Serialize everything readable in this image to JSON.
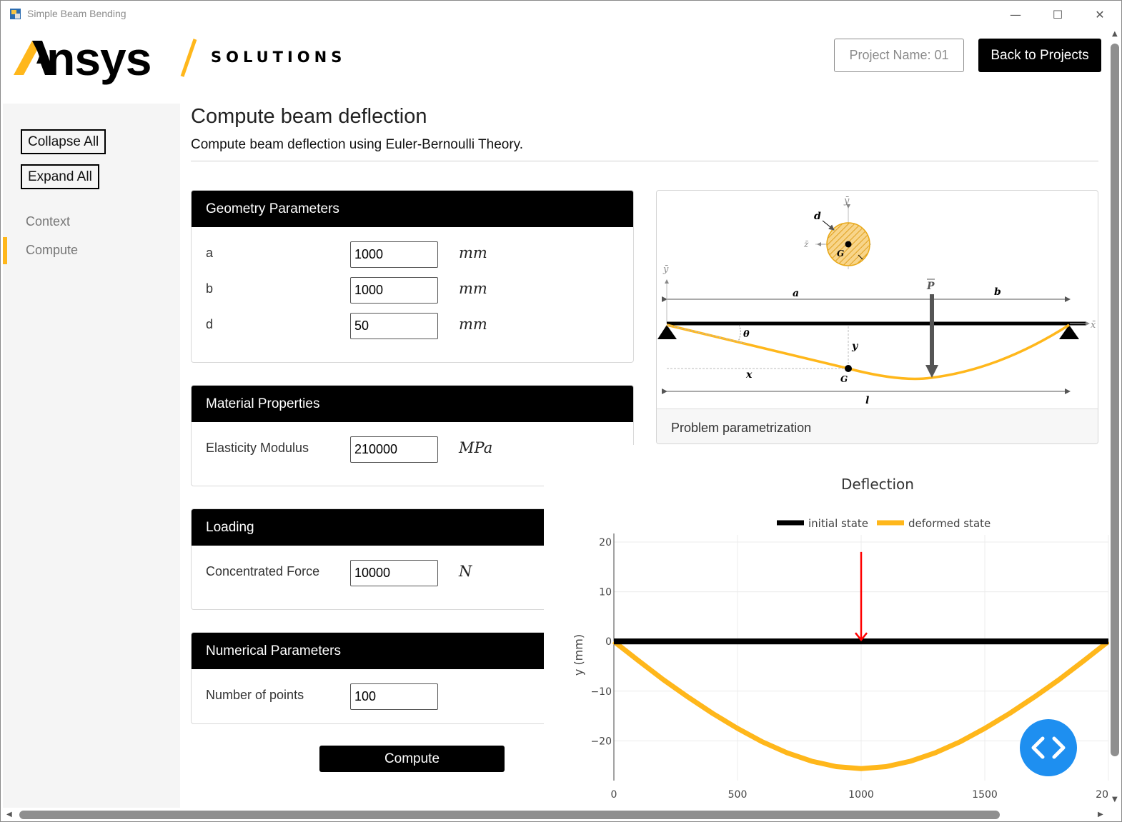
{
  "window": {
    "title": "Simple Beam Bending",
    "minimize": "—",
    "maximize": "☐",
    "close": "✕"
  },
  "header": {
    "logo_text": "nsys",
    "solutions": "SOLUTIONS",
    "project_name": "Project Name: 01",
    "back_label": "Back to Projects"
  },
  "sidebar": {
    "collapse_label": "Collapse All",
    "expand_label": "Expand All",
    "items": [
      {
        "label": "Context",
        "active": false
      },
      {
        "label": "Compute",
        "active": true
      }
    ]
  },
  "main": {
    "title": "Compute beam deflection",
    "subtitle": "Compute beam deflection using Euler-Bernoulli Theory.",
    "cards": {
      "geometry": {
        "title": "Geometry Parameters",
        "rows": [
          {
            "label": "a",
            "value": "1000",
            "unit": "mm"
          },
          {
            "label": "b",
            "value": "1000",
            "unit": "mm"
          },
          {
            "label": "d",
            "value": "50",
            "unit": "mm"
          }
        ]
      },
      "material": {
        "title": "Material Properties",
        "rows": [
          {
            "label": "Elasticity Modulus",
            "value": "210000",
            "unit": "MPa"
          }
        ]
      },
      "loading": {
        "title": "Loading",
        "rows": [
          {
            "label": "Concentrated Force",
            "value": "10000",
            "unit": "N"
          }
        ]
      },
      "numerical": {
        "title": "Numerical Parameters",
        "rows": [
          {
            "label": "Number of points",
            "value": "100"
          }
        ]
      }
    },
    "compute_label": "Compute"
  },
  "figure": {
    "caption": "Problem parametrization",
    "labels": {
      "d": "d",
      "G": "G",
      "y_bar": "ȳ",
      "z_bar": "z̄",
      "x_bar": "x̄",
      "a": "a",
      "b": "b",
      "P": "P",
      "theta": "θ",
      "y": "y",
      "x": "x",
      "l": "l"
    }
  },
  "chart_data": {
    "type": "line",
    "title": "Deflection",
    "ylabel": "y (mm)",
    "xlabel": "",
    "xlim": [
      0,
      2000
    ],
    "ylim": [
      -28,
      20
    ],
    "x_ticks": [
      "0",
      "500",
      "1000",
      "1500",
      "20"
    ],
    "y_ticks": [
      "20",
      "10",
      "0",
      "−10",
      "−20"
    ],
    "legend_position": "top",
    "series": [
      {
        "name": "initial state",
        "color": "#000000",
        "x": [
          0,
          2000
        ],
        "y": [
          0,
          0
        ]
      },
      {
        "name": "deformed state",
        "color": "#FFB71B",
        "x": [
          0,
          100,
          200,
          300,
          400,
          500,
          600,
          700,
          800,
          900,
          1000,
          1100,
          1200,
          1300,
          1400,
          1500,
          1600,
          1700,
          1800,
          1900,
          2000
        ],
        "y": [
          0,
          -3.9,
          -7.7,
          -11.2,
          -14.5,
          -17.5,
          -20.2,
          -22.4,
          -24.1,
          -25.2,
          -25.6,
          -25.2,
          -24.1,
          -22.4,
          -20.2,
          -17.5,
          -14.5,
          -11.2,
          -7.7,
          -3.9,
          0
        ]
      }
    ],
    "force_arrow": {
      "x": 1000,
      "y_from": 18,
      "y_to": 0,
      "color": "#FF0000"
    }
  }
}
